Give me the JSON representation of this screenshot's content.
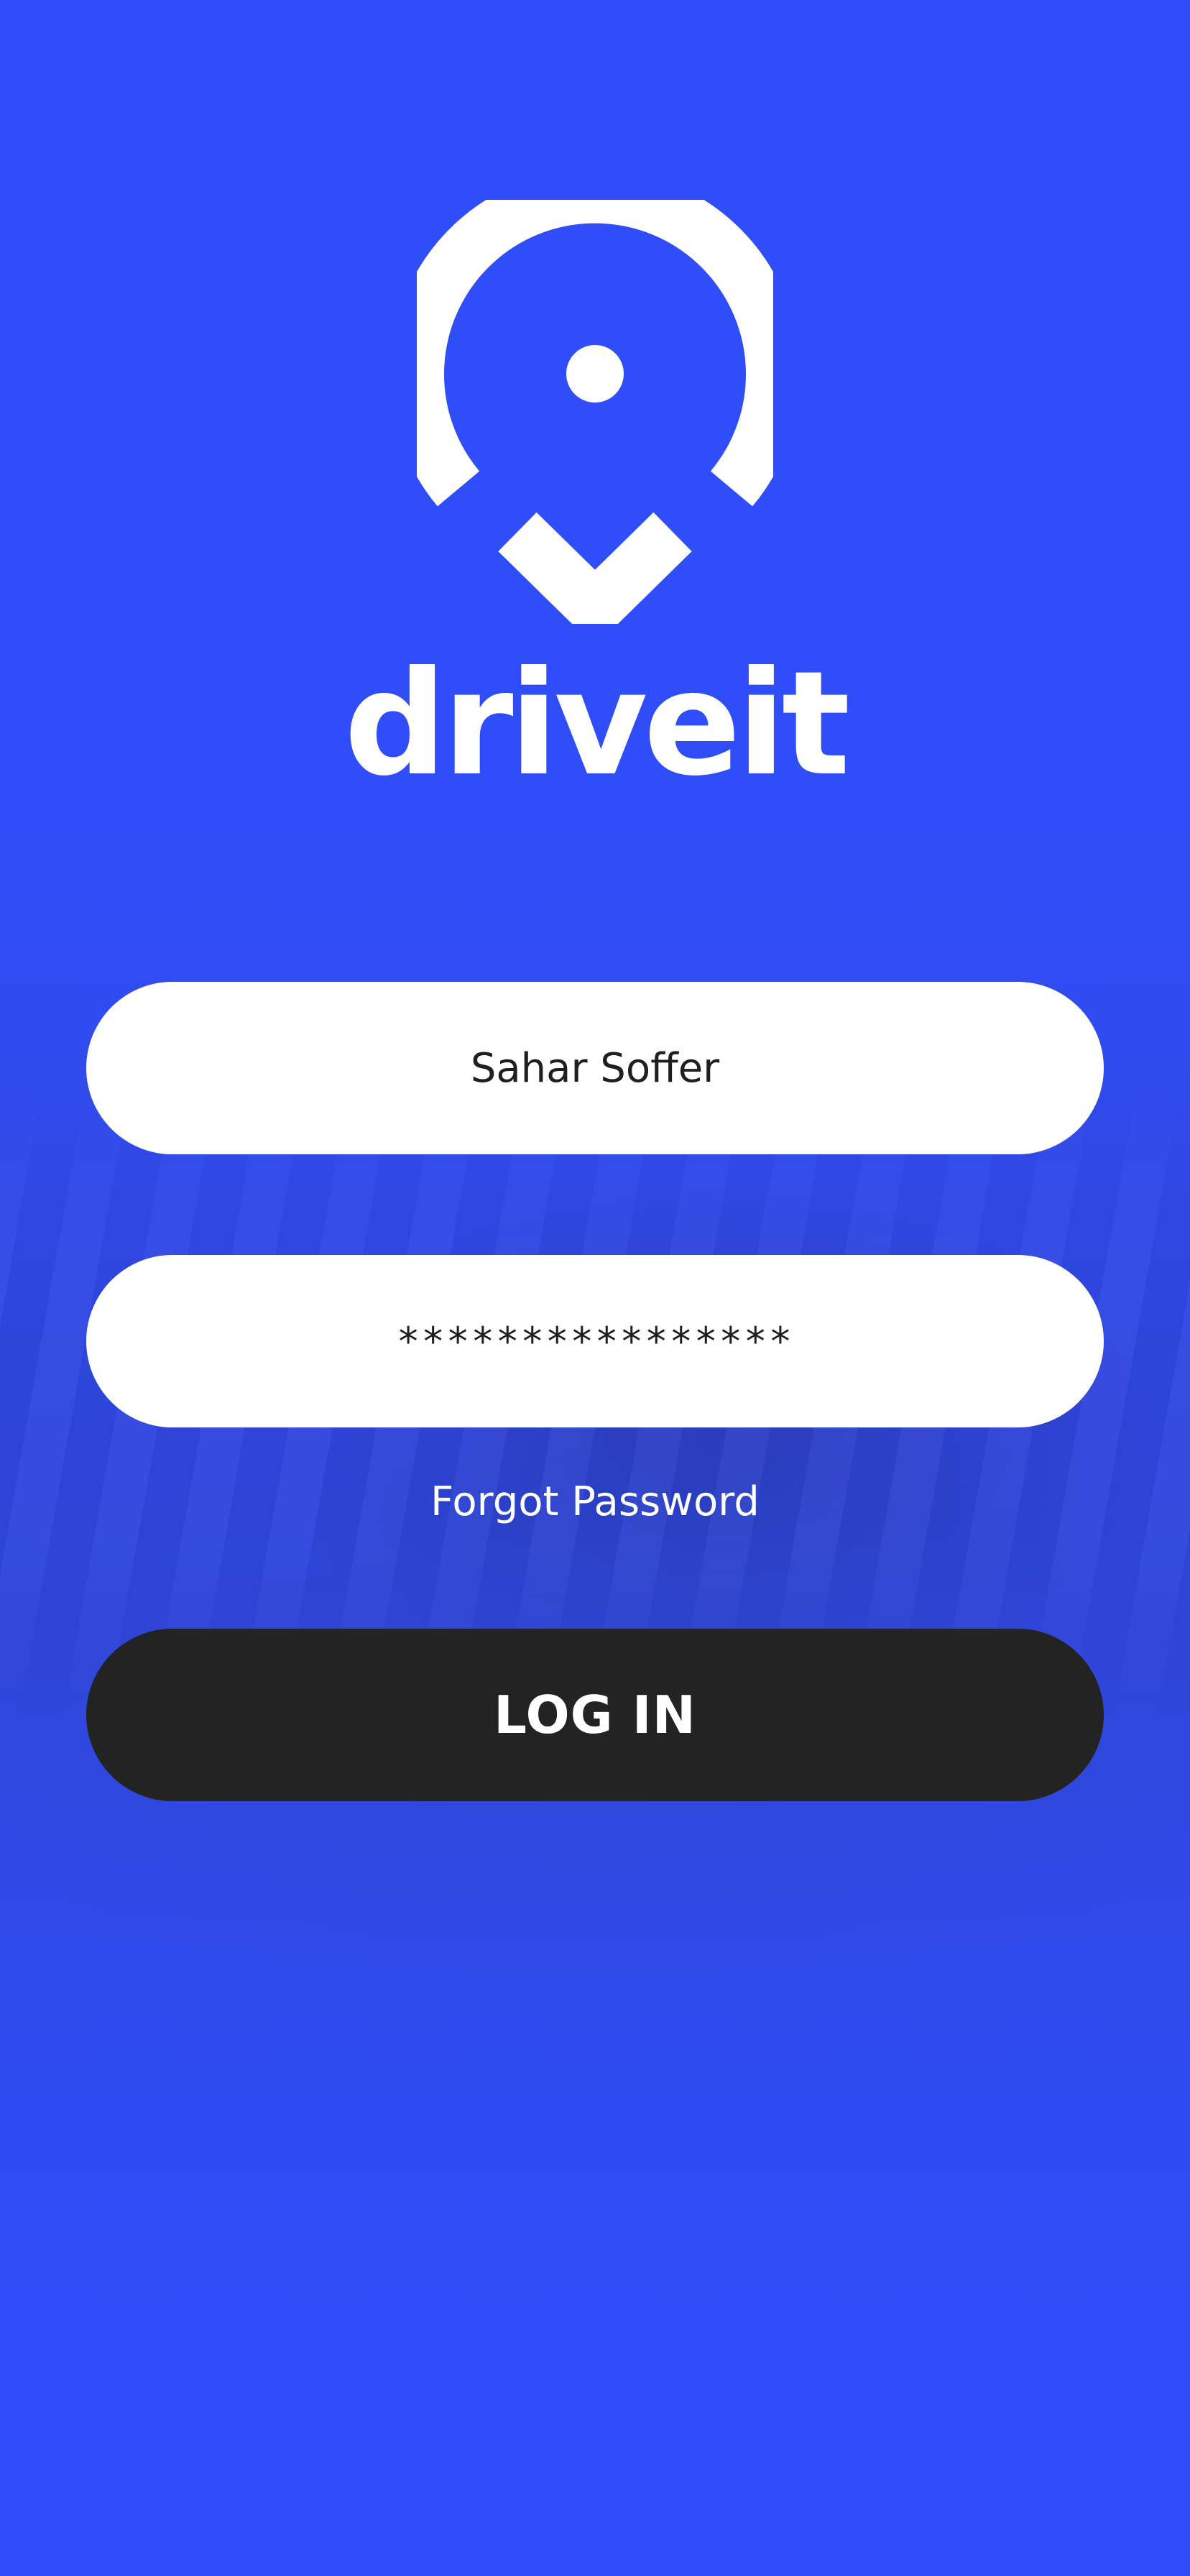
{
  "app": {
    "name": "driveit",
    "brand_color": "#2f4ef9",
    "logo_icon": "map-pin-chevron-icon"
  },
  "login_form": {
    "username_value": "Sahar Soffer",
    "password_value": "****************",
    "forgot_password_label": "Forgot Password",
    "login_button_label": "LOG IN",
    "login_button_color": "#232323"
  }
}
